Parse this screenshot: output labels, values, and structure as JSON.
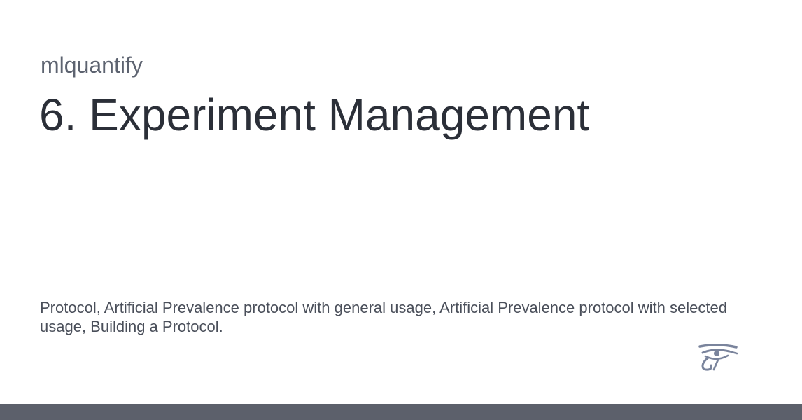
{
  "header": {
    "site_name": "mlquantify",
    "title": "6. Experiment Management"
  },
  "summary": {
    "text": "Protocol, Artificial Prevalence protocol with general usage, Artificial Prevalence protocol with selected usage, Building a Protocol."
  },
  "logo": {
    "icon": "eye-of-horus-icon",
    "color": "#7a849c"
  },
  "footer": {
    "bar_color": "#5c606b"
  }
}
